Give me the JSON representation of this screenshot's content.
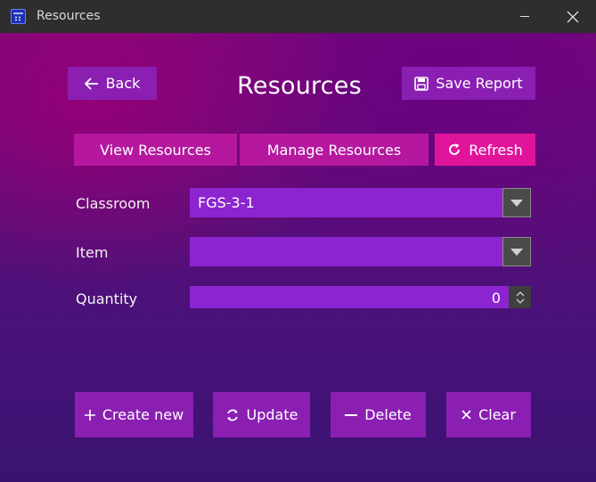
{
  "window": {
    "title": "Resources",
    "minimize_icon": "minimize-icon",
    "close_icon": "close-icon"
  },
  "header": {
    "back_label": "Back",
    "title": "Resources",
    "save_report_label": "Save Report"
  },
  "tabs": {
    "view_label": "View Resources",
    "manage_label": "Manage Resources",
    "refresh_label": "Refresh"
  },
  "form": {
    "classroom_label": "Classroom",
    "classroom_value": "FGS-3-1",
    "item_label": "Item",
    "item_value": "",
    "quantity_label": "Quantity",
    "quantity_value": "0"
  },
  "actions": {
    "create_label": "Create new",
    "update_label": "Update",
    "delete_label": "Delete",
    "clear_label": "Clear"
  },
  "colors": {
    "button_purple": "#8a1fb2",
    "button_pink": "#b5189f",
    "button_hot_pink": "#e0149a",
    "field_purple": "#8c25cf"
  }
}
